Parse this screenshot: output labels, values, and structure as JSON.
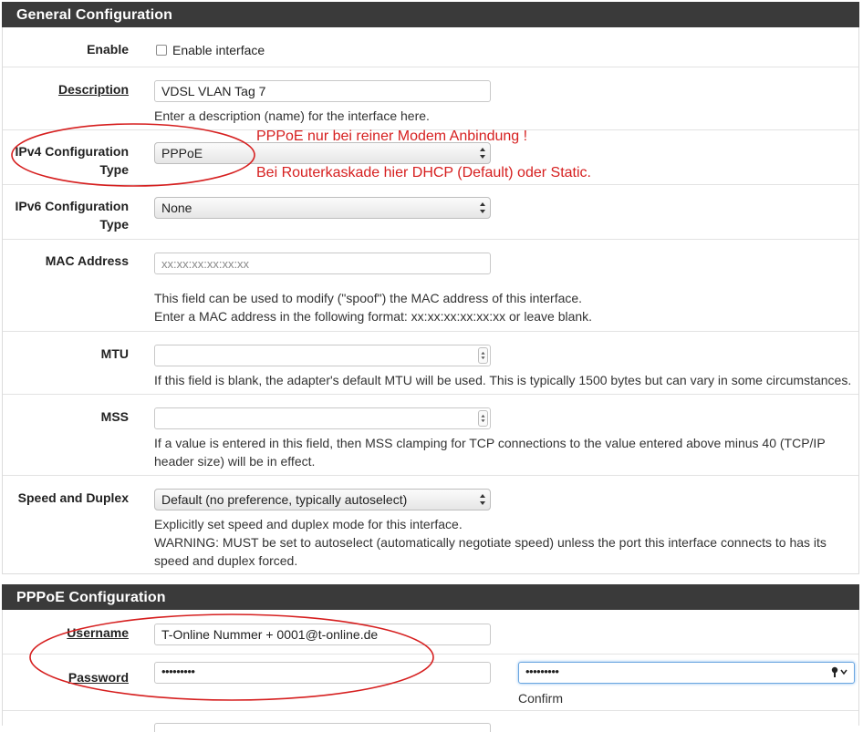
{
  "general": {
    "heading": "General Configuration",
    "enable": {
      "label": "Enable",
      "checkbox_label": "Enable interface",
      "checked": false
    },
    "description": {
      "label": "Description",
      "value": "VDSL VLAN Tag 7",
      "help": "Enter a description (name) for the interface here."
    },
    "ipv4": {
      "label_line1": "IPv4 Configuration",
      "label_line2": "Type",
      "value": "PPPoE"
    },
    "ipv6": {
      "label_line1": "IPv6 Configuration",
      "label_line2": "Type",
      "value": "None"
    },
    "mac": {
      "label": "MAC Address",
      "placeholder": "xx:xx:xx:xx:xx:xx",
      "help_line1": "This field can be used to modify (\"spoof\") the MAC address of this interface.",
      "help_line2": "Enter a MAC address in the following format: xx:xx:xx:xx:xx:xx or leave blank."
    },
    "mtu": {
      "label": "MTU",
      "value": "",
      "help": "If this field is blank, the adapter's default MTU will be used. This is typically 1500 bytes but can vary in some circumstances."
    },
    "mss": {
      "label": "MSS",
      "value": "",
      "help_line1": "If a value is entered in this field, then MSS clamping for TCP connections to the value entered above minus 40 (TCP/IP",
      "help_line2": "header size) will be in effect."
    },
    "speed": {
      "label": "Speed and Duplex",
      "value": "Default (no preference, typically autoselect)",
      "help_line1": "Explicitly set speed and duplex mode for this interface.",
      "help_line2": "WARNING: MUST be set to autoselect (automatically negotiate speed) unless the port this interface connects to has its",
      "help_line3": "speed and duplex forced."
    }
  },
  "pppoe": {
    "heading": "PPPoE Configuration",
    "username": {
      "label": "Username",
      "value": "T-Online Nummer + 0001@t-online.de"
    },
    "password": {
      "label": "Password",
      "value": "•••••••••",
      "confirm_value": "•••••••••",
      "confirm_label": "Confirm"
    }
  },
  "annotations": {
    "line1": "PPPoE nur bei reiner Modem Anbindung !",
    "line2": "Bei Routerkaskade hier DHCP (Default) oder Static.",
    "color": "#d61f1f"
  }
}
